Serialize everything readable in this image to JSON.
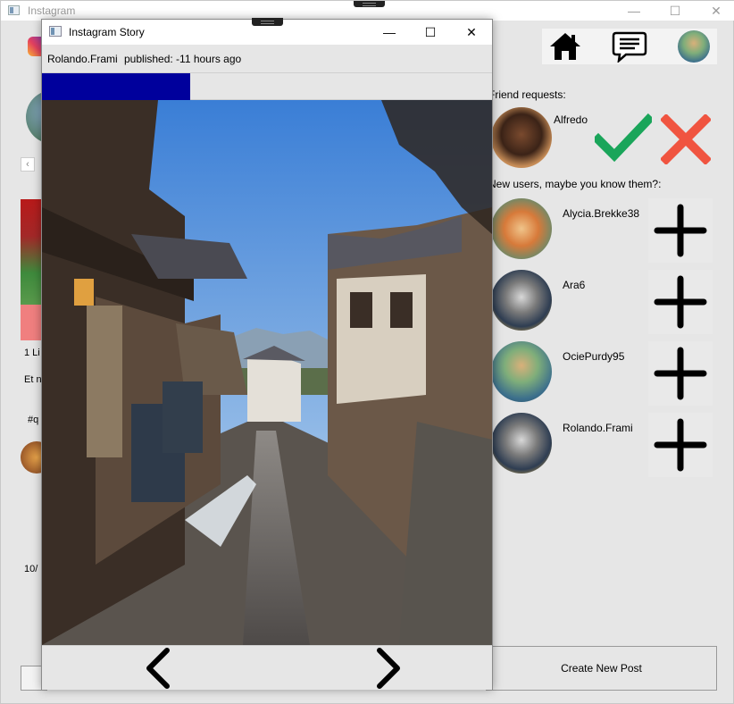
{
  "main_window": {
    "title": "Instagram",
    "controls": {
      "minimize": "—",
      "maximize": "☐",
      "close": "✕"
    }
  },
  "left_column": {
    "likes_text": "1 Li",
    "caption_text": "Et n",
    "tags_text": "#q",
    "date_text": "10/",
    "chevron": "‹"
  },
  "nav": {
    "items": [
      {
        "name": "home",
        "icon": "home-icon"
      },
      {
        "name": "messages",
        "icon": "chat-icon"
      },
      {
        "name": "profile",
        "icon": "avatar"
      }
    ]
  },
  "right_column": {
    "friend_requests_label": "Friend requests:",
    "friend_requests": [
      {
        "username": "Alfredo"
      }
    ],
    "suggestions_label": "New users, maybe you know them?:",
    "suggestions": [
      {
        "username": "Alycia.Brekke38"
      },
      {
        "username": "Ara6"
      },
      {
        "username": "OciePurdy95"
      },
      {
        "username": "Rolando.Frami"
      }
    ],
    "create_post_label": "Create New Post"
  },
  "story_window": {
    "title": "Instagram Story",
    "controls": {
      "minimize": "—",
      "maximize": "☐",
      "close": "✕"
    },
    "author": "Rolando.Frami",
    "published": "published: -11 hours ago",
    "progress": 0.33,
    "prev_label": "‹",
    "next_label": "›"
  },
  "colors": {
    "progress_fill": "#00009c",
    "accept_green": "#1aa55a",
    "reject_red": "#f05440",
    "window_bg": "#e6e6e6"
  }
}
